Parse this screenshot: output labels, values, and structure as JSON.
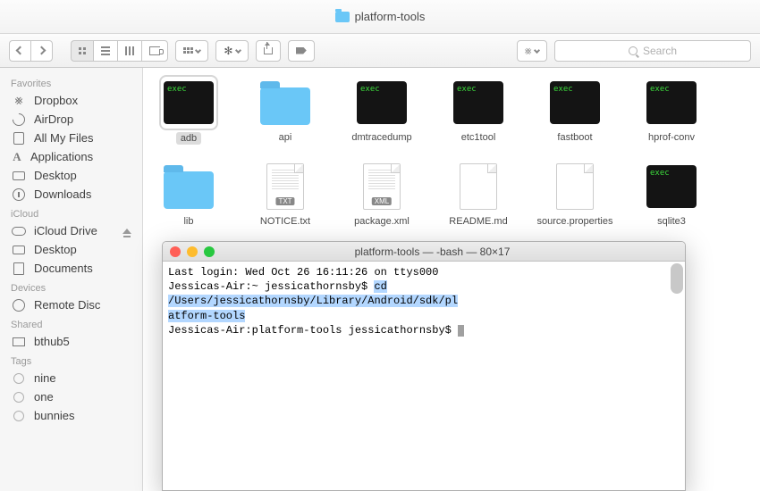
{
  "window": {
    "title": "platform-tools"
  },
  "search": {
    "placeholder": "Search"
  },
  "sidebar": {
    "favorites": {
      "header": "Favorites",
      "items": [
        "Dropbox",
        "AirDrop",
        "All My Files",
        "Applications",
        "Desktop",
        "Downloads"
      ]
    },
    "icloud": {
      "header": "iCloud",
      "items": [
        "iCloud Drive",
        "Desktop",
        "Documents"
      ]
    },
    "devices": {
      "header": "Devices",
      "items": [
        "Remote Disc"
      ]
    },
    "shared": {
      "header": "Shared",
      "items": [
        "bthub5"
      ]
    },
    "tags": {
      "header": "Tags",
      "items": [
        "nine",
        "one",
        "bunnies"
      ]
    }
  },
  "files": {
    "row1": [
      {
        "name": "adb",
        "type": "exec",
        "selected": true
      },
      {
        "name": "api",
        "type": "folder"
      },
      {
        "name": "dmtracedump",
        "type": "exec"
      },
      {
        "name": "etc1tool",
        "type": "exec"
      },
      {
        "name": "fastboot",
        "type": "exec"
      },
      {
        "name": "hprof-conv",
        "type": "exec"
      }
    ],
    "row2": [
      {
        "name": "lib",
        "type": "folder"
      },
      {
        "name": "NOTICE.txt",
        "type": "txt"
      },
      {
        "name": "package.xml",
        "type": "xml"
      },
      {
        "name": "README.md",
        "type": "blank"
      },
      {
        "name": "source.properties",
        "type": "blank"
      },
      {
        "name": "sqlite3",
        "type": "exec"
      }
    ],
    "exec_label": "exec",
    "txt_badge": "TXT",
    "xml_badge": "XML"
  },
  "terminal": {
    "title": "platform-tools — -bash — 80×17",
    "line1": "Last login: Wed Oct 26 16:11:26 on ttys000",
    "prompt1_left": "Jessicas-Air:~ jessicathornsby$ ",
    "cmd_seg1": "cd /Users/jessicathornsby/Library/Android/sdk/pl",
    "cmd_seg2": "atform-tools",
    "prompt2": "Jessicas-Air:platform-tools jessicathornsby$ "
  }
}
